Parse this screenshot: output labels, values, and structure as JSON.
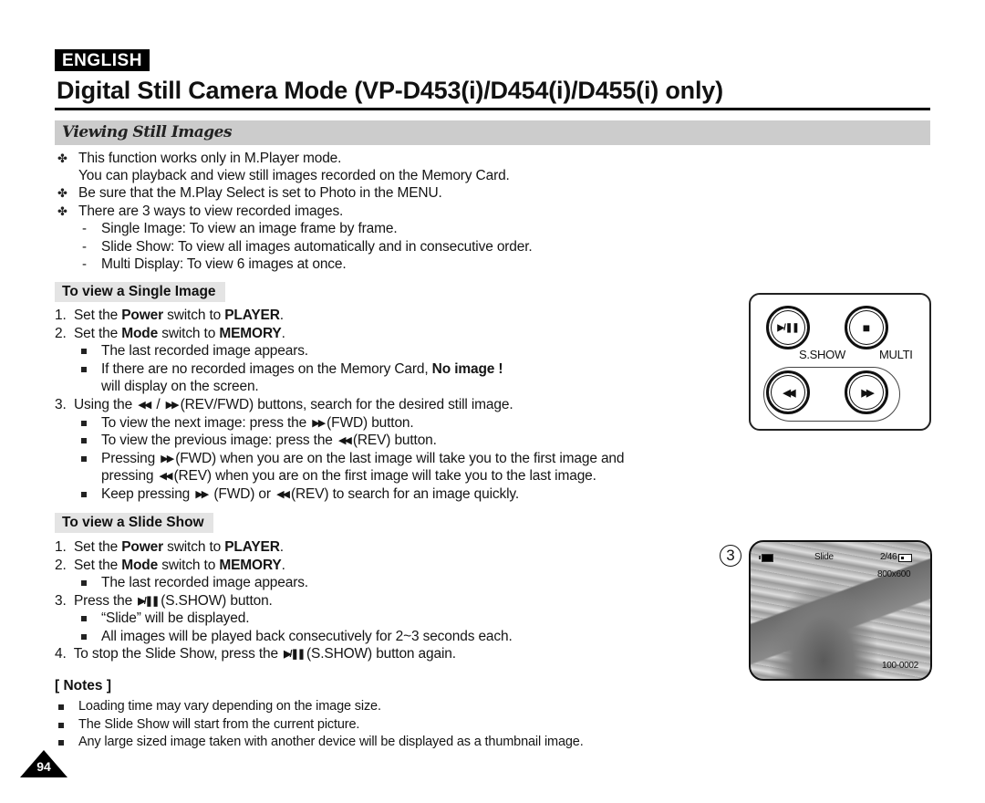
{
  "header": {
    "language_badge": "ENGLISH",
    "title": "Digital Still Camera Mode (VP-D453(i)/D454(i)/D455(i) only)",
    "section_title": "Viewing Still Images"
  },
  "intro": {
    "bullet_marker": "✤",
    "items": [
      "This function works only in M.Player mode.",
      "You can playback and view still images recorded on the Memory Card.",
      "Be sure that the M.Play Select is set to Photo in the MENU.",
      "There are 3 ways to view recorded images."
    ],
    "ways": [
      "Single Image: To view an image frame by frame.",
      "Slide Show: To view all images automatically and in consecutive order.",
      "Multi Display: To view 6 images at once."
    ]
  },
  "single_image": {
    "heading": "To view a Single Image",
    "step1": {
      "num": "1.",
      "pre": "Set the ",
      "b1": "Power",
      "mid": " switch to ",
      "b2": "PLAYER",
      "post": "."
    },
    "step2": {
      "num": "2.",
      "pre": "Set the ",
      "b1": "Mode",
      "mid": " switch to ",
      "b2": "MEMORY",
      "post": "."
    },
    "step2_notes": [
      "The last recorded image appears.",
      "If there are no recorded images on the Memory Card, ",
      "No image !",
      "will display on the screen."
    ],
    "step3": {
      "num": "3.",
      "pre": "Using the ",
      "rev": "◀◀",
      "slash": " / ",
      "fwd": "▶▶",
      "post": "(REV/FWD) buttons, search for the desired still image."
    },
    "step3_notes": {
      "next": {
        "pre": "To view the next image: press the ",
        "post": "(FWD) button."
      },
      "prev": {
        "pre": "To view the previous image: press the ",
        "post": "(REV) button."
      },
      "wrap1": {
        "pre": "Pressing ",
        "post": "(FWD) when you are on the last image will take you to the first image and"
      },
      "wrap2": {
        "pre": "pressing ",
        "post": "(REV) when you are on the first image will take you to the last image."
      },
      "keep": {
        "pre": "Keep pressing ",
        "mid": " (FWD) or ",
        "post": "(REV) to search for an image quickly."
      }
    }
  },
  "slide_show": {
    "heading": "To view a Slide Show",
    "step1": {
      "num": "1.",
      "pre": "Set the ",
      "b1": "Power",
      "mid": " switch to ",
      "b2": "PLAYER",
      "post": "."
    },
    "step2": {
      "num": "2.",
      "pre": "Set the ",
      "b1": "Mode",
      "mid": " switch to ",
      "b2": "MEMORY",
      "post": "."
    },
    "step2_note": "The last recorded image appears.",
    "step3": {
      "num": "3.",
      "pre": "Press the ",
      "icon": "▶/❚❚",
      "post": "(S.SHOW) button."
    },
    "step3_notes": [
      "“Slide” will be displayed.",
      "All images will be played back consecutively for 2~3 seconds each."
    ],
    "step4": {
      "num": "4.",
      "pre": "To stop the Slide Show, press the ",
      "icon": "▶/❚❚",
      "post": "(S.SHOW) button again."
    }
  },
  "notes": {
    "heading": "[ Notes ]",
    "items": [
      "Loading time may vary depending on the image size.",
      "The Slide Show will start from the current picture.",
      "Any large sized image taken with another device will be displayed as a thumbnail image."
    ]
  },
  "button_panel": {
    "play_pause_icon": "▶/❚❚",
    "stop_icon": "■",
    "rev_icon": "◀◀",
    "fwd_icon": "▶▶",
    "sshow_label": "S.SHOW",
    "multi_label": "MULTI"
  },
  "lcd_screen": {
    "step_number": "3",
    "mode_label": "Slide",
    "counter": "2/46",
    "resolution": "800x600",
    "file_number": "100-0002"
  },
  "page_number": "94"
}
